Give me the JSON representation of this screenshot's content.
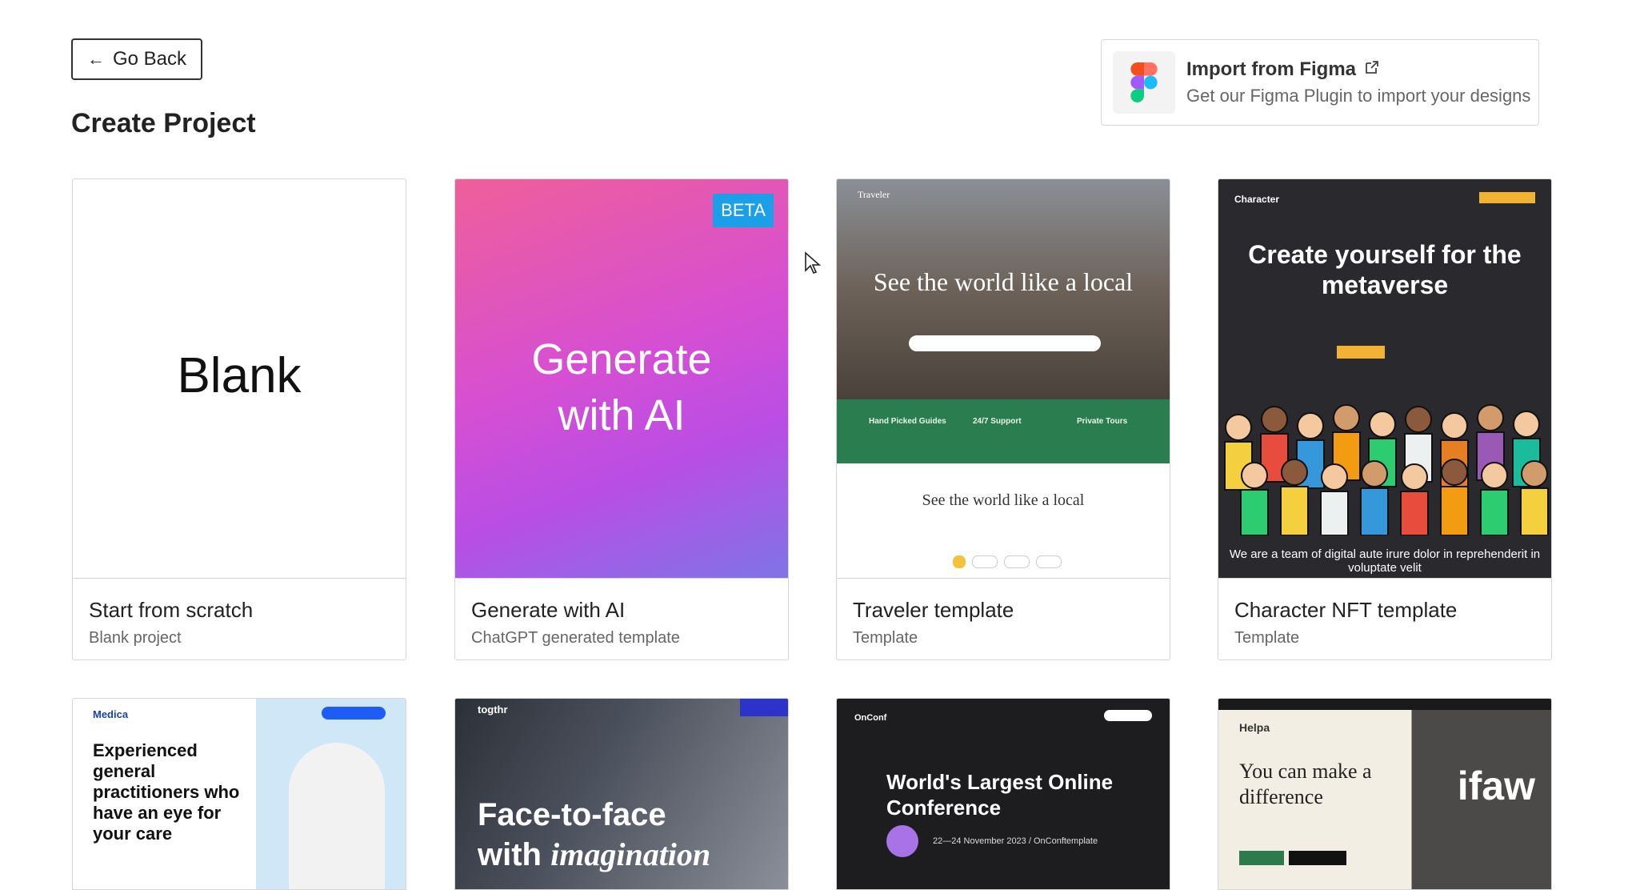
{
  "nav": {
    "back_arrow": "←",
    "back_label": "Go Back"
  },
  "page": {
    "title": "Create Project"
  },
  "figma": {
    "icon": "figma-logo-icon",
    "title": "Import from Figma",
    "subtitle": "Get our Figma Plugin to import your designs"
  },
  "cards": [
    {
      "name": "Start from scratch",
      "sub": "Blank project",
      "thumb_text": "Blank"
    },
    {
      "name": "Generate with AI",
      "sub": "ChatGPT generated template",
      "thumb_text": "Generate with AI",
      "badge": "BETA"
    },
    {
      "name": "Traveler template",
      "sub": "Template",
      "thumb_brand": "Traveler",
      "headline": "See the world like a local",
      "cols": [
        "Hand Picked Guides",
        "24/7 Support",
        "Private Tours"
      ],
      "sub_headline": "See the world like a local"
    },
    {
      "name": "Character NFT template",
      "sub": "Template",
      "thumb_brand": "Character",
      "headline": "Create yourself for the metaverse",
      "foot": "We are a team of digital aute irure dolor in reprehenderit in voluptate velit"
    }
  ],
  "row2": [
    {
      "brand": "Medica",
      "headline": "Experienced general practitioners who have an eye for your care"
    },
    {
      "brand": "togthr",
      "headline_1": "Face-to-face",
      "headline_2_plain": "with",
      "headline_2_em": "imagination"
    },
    {
      "brand": "OnConf",
      "headline": "World's Largest Online Conference",
      "date": "22—24 November 2023 / OnConftemplate"
    },
    {
      "brand": "Helpa",
      "headline": "You can make a difference",
      "image_text": "ifaw"
    }
  ],
  "colors": {
    "ai_gradient_start": "#ef5f9a",
    "ai_gradient_end": "#7f74e6",
    "beta": "#1a9fe8",
    "nft_bg": "#2a2a2e",
    "traveler_green": "#2a7d4f"
  }
}
